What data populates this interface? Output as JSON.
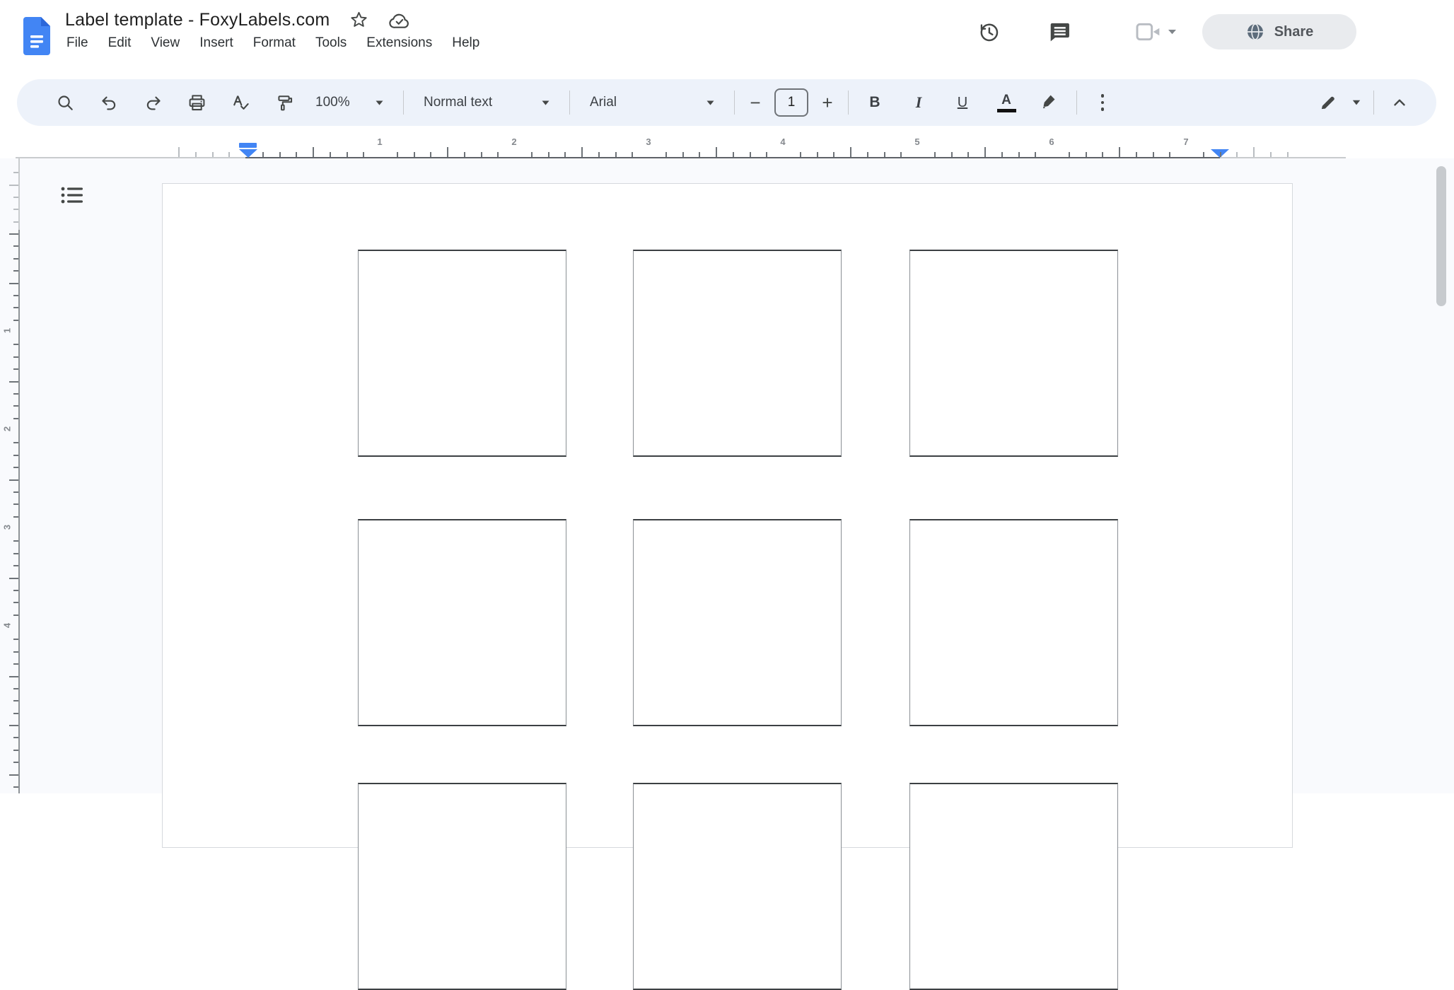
{
  "header": {
    "title": "Label template - FoxyLabels.com",
    "menu_items": [
      "File",
      "Edit",
      "View",
      "Insert",
      "Format",
      "Tools",
      "Extensions",
      "Help"
    ],
    "share_button": {
      "label": "Share"
    },
    "icons": [
      "docs-logo",
      "star",
      "cloud-saved",
      "version-history",
      "comments",
      "video-call",
      "share-globe"
    ]
  },
  "toolbar": {
    "zoom_value": "100%",
    "paragraph_style_value": "Normal text",
    "font_family_value": "Arial",
    "font_size_value": "1",
    "decrease_font_label": "−",
    "increase_font_label": "+",
    "bold_label": "B",
    "italic_label": "I",
    "underline_label": "U",
    "text_color_label": "A",
    "icons": [
      "search",
      "undo",
      "redo",
      "print",
      "spellcheck",
      "paint-format",
      "highlight",
      "more-options",
      "editing-mode-pen",
      "collapse-chevron"
    ]
  },
  "rulers": {
    "horizontal_inch_labels": [
      "1",
      "2",
      "3",
      "4",
      "5",
      "6",
      "7"
    ],
    "vertical_inch_labels": [
      "1",
      "2",
      "3",
      "4"
    ]
  },
  "document_page": {
    "label_grid": {
      "columns": 3,
      "rows": 3
    }
  },
  "colors": {
    "accent_blue": "#4285f4",
    "toolbar_background": "#edf2fa",
    "canvas_background": "#f9fafd",
    "icon_gray": "#444746",
    "disabled_icon_gray": "#b8bcc2",
    "share_pill_background": "#e9ebee"
  }
}
